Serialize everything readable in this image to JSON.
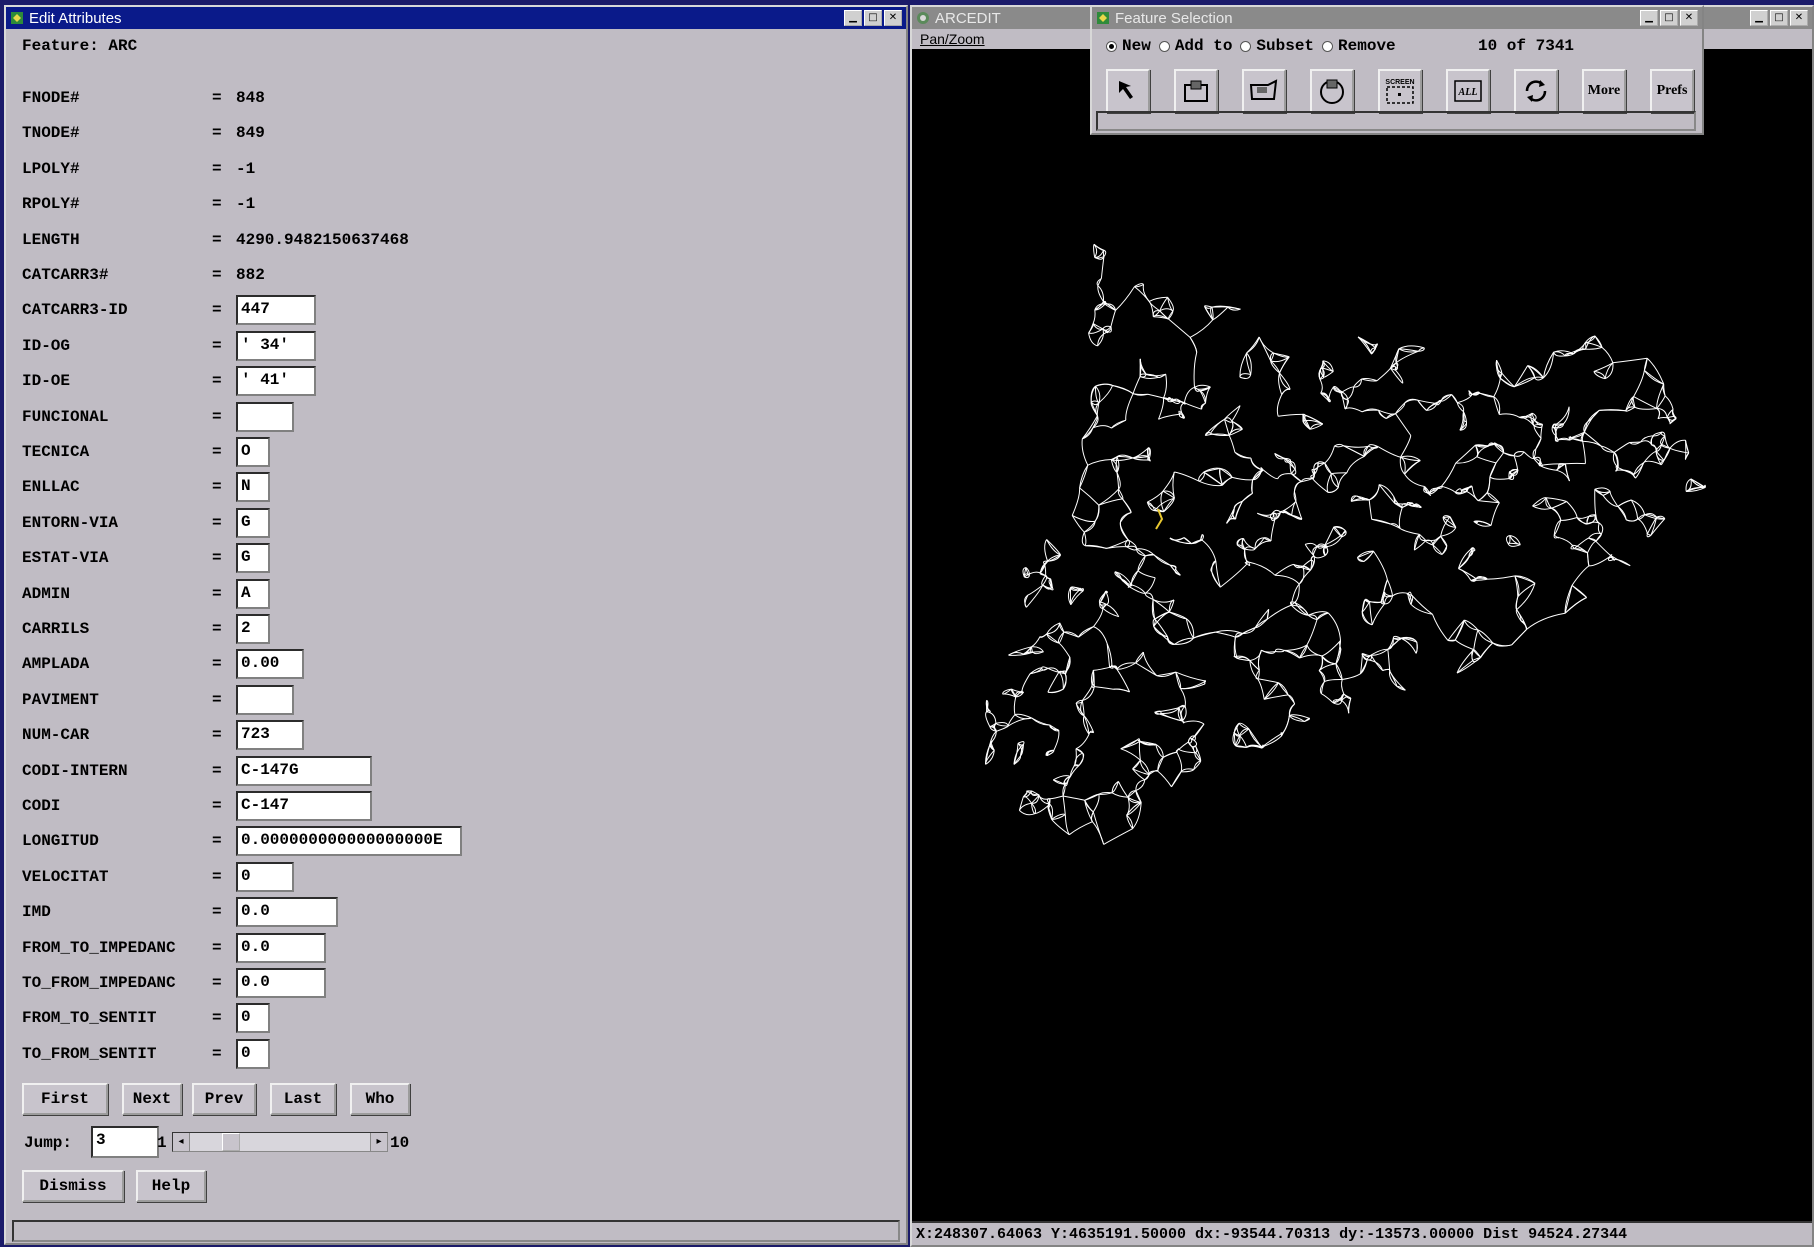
{
  "edit_window": {
    "title": "Edit Attributes",
    "feature_label": "Feature:",
    "feature_value": "ARC",
    "attributes": [
      {
        "name": "FNODE#",
        "value": "848",
        "editable": false
      },
      {
        "name": "TNODE#",
        "value": "849",
        "editable": false
      },
      {
        "name": "LPOLY#",
        "value": "-1",
        "editable": false
      },
      {
        "name": "RPOLY#",
        "value": "-1",
        "editable": false
      },
      {
        "name": "LENGTH",
        "value": "4290.9482150637468",
        "editable": false
      },
      {
        "name": "CATCARR3#",
        "value": "882",
        "editable": false
      },
      {
        "name": "CATCARR3-ID",
        "value": "447",
        "editable": true
      },
      {
        "name": "ID-OG",
        "value": "' 34'",
        "editable": true
      },
      {
        "name": "ID-OE",
        "value": "' 41'",
        "editable": true
      },
      {
        "name": "FUNCIONAL",
        "value": "",
        "editable": true
      },
      {
        "name": "TECNICA",
        "value": "O",
        "editable": true
      },
      {
        "name": "ENLLAC",
        "value": "N",
        "editable": true
      },
      {
        "name": "ENTORN-VIA",
        "value": "G",
        "editable": true
      },
      {
        "name": "ESTAT-VIA",
        "value": "G",
        "editable": true
      },
      {
        "name": "ADMIN",
        "value": "A",
        "editable": true
      },
      {
        "name": "CARRILS",
        "value": "2",
        "editable": true
      },
      {
        "name": "AMPLADA",
        "value": "0.00",
        "editable": true
      },
      {
        "name": "PAVIMENT",
        "value": "",
        "editable": true
      },
      {
        "name": "NUM-CAR",
        "value": "723",
        "editable": true
      },
      {
        "name": "CODI-INTERN",
        "value": "C-147G",
        "editable": true
      },
      {
        "name": "CODI",
        "value": "C-147",
        "editable": true
      },
      {
        "name": "LONGITUD",
        "value": "0.000000000000000000E",
        "editable": true
      },
      {
        "name": "VELOCITAT",
        "value": "0",
        "editable": true
      },
      {
        "name": "IMD",
        "value": "0.0",
        "editable": true
      },
      {
        "name": "FROM_TO_IMPEDANC",
        "value": "0.0",
        "editable": true
      },
      {
        "name": "TO_FROM_IMPEDANC",
        "value": "0.0",
        "editable": true
      },
      {
        "name": "FROM_TO_SENTIT",
        "value": "0",
        "editable": true
      },
      {
        "name": "TO_FROM_SENTIT",
        "value": "0",
        "editable": true
      }
    ],
    "nav_buttons": [
      "First",
      "Next",
      "Prev",
      "Last",
      "Who"
    ],
    "jump_label": "Jump:",
    "jump_value": "3",
    "slider_min": "1",
    "slider_max": "10",
    "slider_position": 0.2,
    "dismiss_label": "Dismiss",
    "help_label": "Help"
  },
  "arcedit_window": {
    "title": "ARCEDIT",
    "menu_label": "Pan/Zoom",
    "status": "X:248307.64063 Y:4635191.50000 dx:-93544.70313 dy:-13573.00000 Dist 94524.27344"
  },
  "feature_selection": {
    "title": "Feature Selection",
    "modes": [
      "New",
      "Add to",
      "Subset",
      "Remove"
    ],
    "selected_mode": "New",
    "count_text": "10 of 7341",
    "tool_buttons": [
      {
        "name": "pointer-icon",
        "label": ""
      },
      {
        "name": "box-select-icon",
        "label": ""
      },
      {
        "name": "flag-select-icon",
        "label": ""
      },
      {
        "name": "circle-select-icon",
        "label": ""
      },
      {
        "name": "screen-select-icon",
        "label": "SCREEN"
      },
      {
        "name": "all-select-icon",
        "label": "ALL"
      },
      {
        "name": "refresh-icon",
        "label": ""
      },
      {
        "name": "more-button",
        "label": "More"
      },
      {
        "name": "prefs-button",
        "label": "Prefs"
      }
    ]
  },
  "colors": {
    "titlebar_active": "#0a1a8a",
    "titlebar_inactive": "#8a8a8a",
    "panel_bg": "#c0bcc4",
    "map_bg": "#000000",
    "road_color": "#ffffff"
  }
}
